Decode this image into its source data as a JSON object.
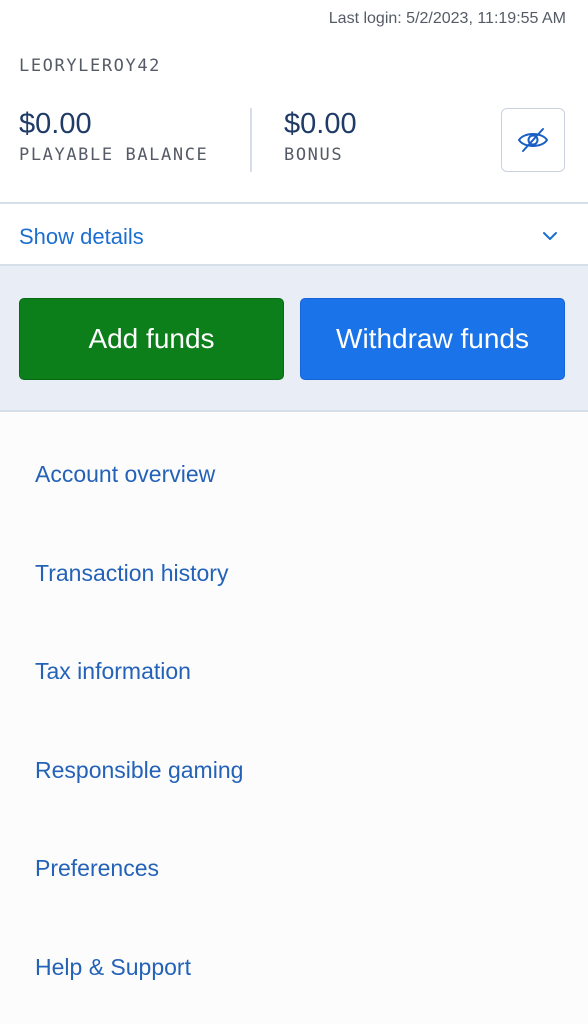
{
  "header": {
    "last_login": "Last login: 5/2/2023, 11:19:55 AM",
    "username": "LEORYLEROY42"
  },
  "balances": {
    "playable": {
      "amount": "$0.00",
      "label": "PLAYABLE BALANCE"
    },
    "bonus": {
      "amount": "$0.00",
      "label": "BONUS"
    }
  },
  "icons": {
    "visibility_toggle": "eye-slash-icon",
    "details_toggle": "chevron-down-icon"
  },
  "details": {
    "label": "Show details"
  },
  "actions": {
    "add_funds": "Add funds",
    "withdraw_funds": "Withdraw funds"
  },
  "colors": {
    "add_funds": "#0c7f1a",
    "withdraw_funds": "#1a73e8",
    "link": "#2462b8",
    "panel_bg": "#e9eef6"
  },
  "menu": {
    "items": [
      {
        "label": "Account overview"
      },
      {
        "label": "Transaction history"
      },
      {
        "label": "Tax information"
      },
      {
        "label": "Responsible gaming"
      },
      {
        "label": "Preferences"
      },
      {
        "label": "Help & Support"
      }
    ]
  }
}
